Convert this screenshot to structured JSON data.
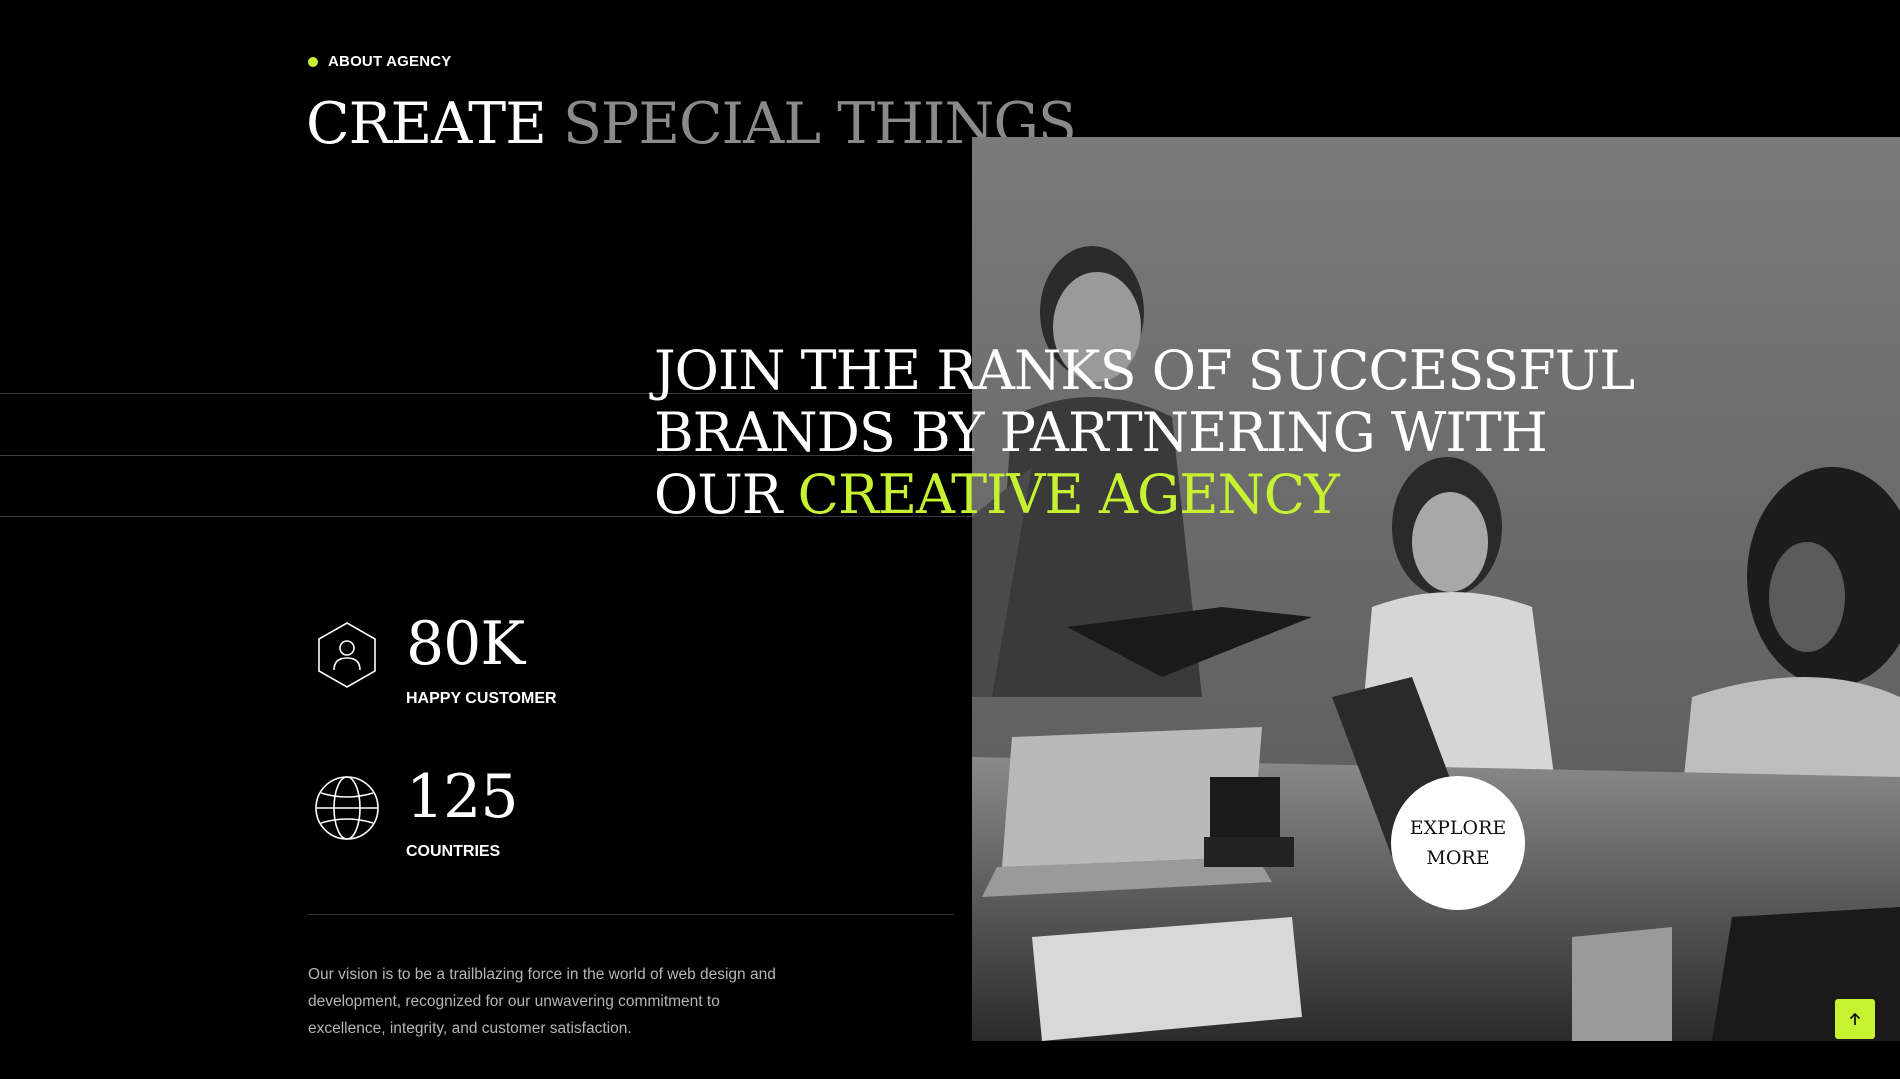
{
  "eyebrow": {
    "label": "ABOUT AGENCY"
  },
  "title": {
    "part1": "CREATE",
    "part2": "SPECIAL THINGS"
  },
  "headline": {
    "line1": "JOIN THE RANKS OF SUCCESSFUL",
    "line2": "BRANDS BY PARTNERING WITH",
    "line3_prefix": "OUR",
    "line3_accent": "CREATIVE AGENCY"
  },
  "stats": [
    {
      "value": "80K",
      "label": "HAPPY CUSTOMER",
      "icon": "user-hexagon-icon"
    },
    {
      "value": "125",
      "label": "COUNTRIES",
      "icon": "globe-icon"
    }
  ],
  "vision": {
    "text": "Our vision is to be a trailblazing force in the world of web design and development, recognized for our unwavering commitment to excellence, integrity, and customer satisfaction."
  },
  "explore": {
    "line1": "EXPLORE",
    "line2": "MORE"
  },
  "scroll_top": {
    "icon": "arrow-up-icon"
  },
  "colors": {
    "background": "#000000",
    "accent": "#c6f232",
    "muted_title": "#8a8a8a",
    "body_text": "#b5b5b5"
  }
}
